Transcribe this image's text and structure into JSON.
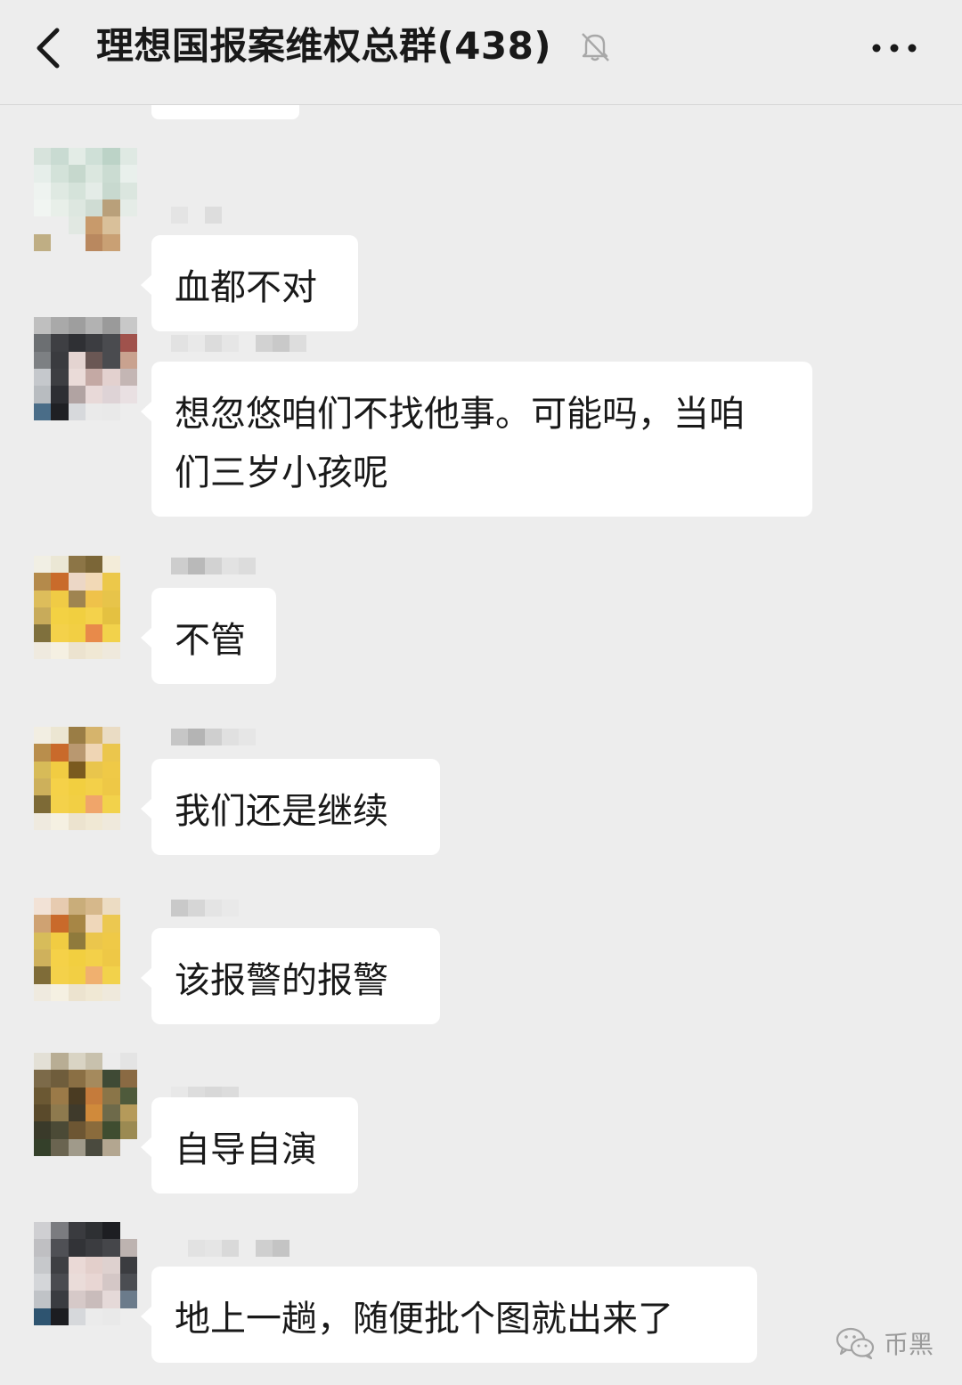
{
  "header": {
    "title": "理想国报案维权总群(438)",
    "back_icon": "chevron-left-icon",
    "mute_icon": "bell-off-icon",
    "more_icon": "more-dots-icon"
  },
  "messages": [
    {
      "text": "血都不对",
      "avatar": "pixelated-avatar"
    },
    {
      "text": "想忽悠咱们不找他事。可能吗，当咱\n们三岁小孩呢",
      "avatar": "pixelated-avatar"
    },
    {
      "text": "不管",
      "avatar": "pixelated-avatar"
    },
    {
      "text": "我们还是继续",
      "avatar": "pixelated-avatar"
    },
    {
      "text": "该报警的报警",
      "avatar": "pixelated-avatar"
    },
    {
      "text": "自导自演",
      "avatar": "pixelated-avatar"
    },
    {
      "text": "地上一趟，随便批个图就出来了",
      "avatar": "pixelated-avatar"
    }
  ],
  "watermark": {
    "text": "币黑",
    "icon": "wechat-icon"
  },
  "colors": {
    "background": "#ededed",
    "bubble": "#ffffff",
    "text": "#191919"
  }
}
